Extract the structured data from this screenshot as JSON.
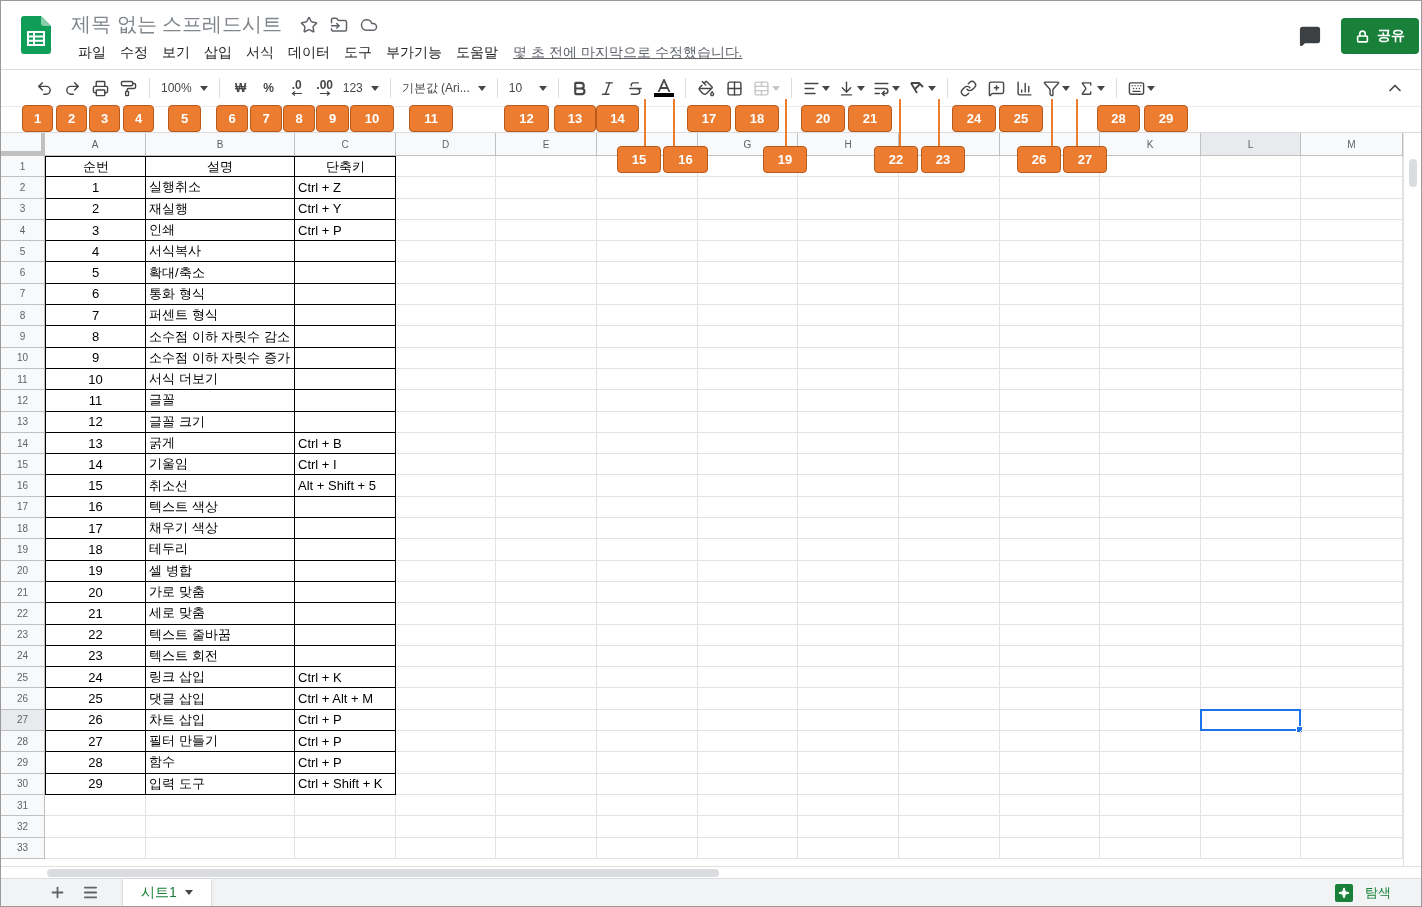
{
  "document": {
    "title": "제목 없는 스프레드시트",
    "last_edit": "몇 초 전에 마지막으로 수정했습니다."
  },
  "menu": [
    "파일",
    "수정",
    "보기",
    "삽입",
    "서식",
    "데이터",
    "도구",
    "부가기능",
    "도움말"
  ],
  "share_button": {
    "label": "공유"
  },
  "toolbar": {
    "groups": [
      [
        {
          "kind": "icon",
          "disabled": false
        },
        {
          "kind": "icon",
          "disabled": false
        },
        {
          "kind": "icon",
          "disabled": false
        },
        {
          "kind": "icon",
          "disabled": false
        }
      ],
      [
        {
          "kind": "dropdown",
          "label": "100%",
          "disabled": false
        }
      ],
      [
        {
          "kind": "text",
          "label": "₩",
          "disabled": false
        },
        {
          "kind": "text",
          "label": "%",
          "disabled": false
        },
        {
          "kind": "decimal",
          "label": ".0",
          "disabled": false
        },
        {
          "kind": "decimal",
          "label": ".00",
          "disabled": false
        },
        {
          "kind": "dropdown",
          "label": "123",
          "disabled": false
        }
      ],
      [
        {
          "kind": "dropdown",
          "label": "기본값 (Ari...",
          "disabled": false
        }
      ],
      [
        {
          "kind": "dropdown",
          "label": "10",
          "disabled": false
        }
      ],
      [
        {
          "kind": "icon",
          "disabled": false
        },
        {
          "kind": "icon",
          "disabled": false
        },
        {
          "kind": "icon",
          "disabled": false
        },
        {
          "kind": "icon",
          "disabled": false
        }
      ],
      [
        {
          "kind": "icon",
          "disabled": false
        },
        {
          "kind": "icon",
          "disabled": false
        },
        {
          "kind": "icon",
          "disabled": true
        }
      ],
      [
        {
          "kind": "icon",
          "disabled": false
        },
        {
          "kind": "icon",
          "disabled": false
        },
        {
          "kind": "icon",
          "disabled": false
        },
        {
          "kind": "icon",
          "disabled": false
        }
      ],
      [
        {
          "kind": "icon",
          "disabled": false
        },
        {
          "kind": "icon",
          "disabled": false
        },
        {
          "kind": "icon",
          "disabled": false
        },
        {
          "kind": "icon",
          "disabled": false
        },
        {
          "kind": "icon",
          "disabled": false
        }
      ],
      [
        {
          "kind": "icon",
          "disabled": false
        }
      ]
    ]
  },
  "callouts": [
    {
      "label": "1"
    },
    {
      "label": "2"
    },
    {
      "label": "3"
    },
    {
      "label": "4"
    },
    {
      "label": "5"
    },
    {
      "label": "6"
    },
    {
      "label": "7"
    },
    {
      "label": "8"
    },
    {
      "label": "9"
    },
    {
      "label": "10"
    },
    {
      "label": "11"
    },
    {
      "label": "12"
    },
    {
      "label": "13"
    },
    {
      "label": "14"
    },
    {
      "label": "15"
    },
    {
      "label": "16"
    },
    {
      "label": "17"
    },
    {
      "label": "18"
    },
    {
      "label": "19"
    },
    {
      "label": "20"
    },
    {
      "label": "21"
    },
    {
      "label": "22"
    },
    {
      "label": "23"
    },
    {
      "label": "24"
    },
    {
      "label": "25"
    },
    {
      "label": "26"
    },
    {
      "label": "27"
    },
    {
      "label": "28"
    },
    {
      "label": "29"
    }
  ],
  "grid": {
    "columns": [
      {
        "label": "A",
        "selected": false
      },
      {
        "label": "B",
        "selected": false
      },
      {
        "label": "C",
        "selected": false
      },
      {
        "label": "D",
        "selected": false
      },
      {
        "label": "E",
        "selected": false
      },
      {
        "selected": false
      },
      {
        "label": "G",
        "selected": false
      },
      {
        "label": "H",
        "selected": false
      },
      {
        "selected": false
      },
      {
        "selected": false
      },
      {
        "label": "K",
        "selected": false
      },
      {
        "label": "L",
        "selected": true
      },
      {
        "label": "M",
        "selected": false
      }
    ],
    "rows": [
      {
        "number": "1",
        "selected": false,
        "cells": [
          "순번",
          "설명",
          "단축키"
        ]
      },
      {
        "number": "2",
        "selected": false,
        "cells": [
          "1",
          "실행취소",
          "Ctrl + Z"
        ]
      },
      {
        "number": "3",
        "selected": false,
        "cells": [
          "2",
          "재실행",
          "Ctrl + Y"
        ]
      },
      {
        "number": "4",
        "selected": false,
        "cells": [
          "3",
          "인쇄",
          "Ctrl + P"
        ]
      },
      {
        "number": "5",
        "selected": false,
        "cells": [
          "4",
          "서식복사"
        ]
      },
      {
        "number": "6",
        "selected": false,
        "cells": [
          "5",
          "확대/축소"
        ]
      },
      {
        "number": "7",
        "selected": false,
        "cells": [
          "6",
          "통화 형식"
        ]
      },
      {
        "number": "8",
        "selected": false,
        "cells": [
          "7",
          "퍼센트 형식"
        ]
      },
      {
        "number": "9",
        "selected": false,
        "cells": [
          "8",
          "소수점 이하 자릿수 감소"
        ]
      },
      {
        "number": "10",
        "selected": false,
        "cells": [
          "9",
          "소수점 이하 자릿수 증가"
        ]
      },
      {
        "number": "11",
        "selected": false,
        "cells": [
          "10",
          "서식 더보기"
        ]
      },
      {
        "number": "12",
        "selected": false,
        "cells": [
          "11",
          "글꼴"
        ]
      },
      {
        "number": "13",
        "selected": false,
        "cells": [
          "12",
          "글꼴 크기"
        ]
      },
      {
        "number": "14",
        "selected": false,
        "cells": [
          "13",
          "굵게",
          "Ctrl + B"
        ]
      },
      {
        "number": "15",
        "selected": false,
        "cells": [
          "14",
          "기울임",
          "Ctrl + I"
        ]
      },
      {
        "number": "16",
        "selected": false,
        "cells": [
          "15",
          "취소선",
          "Alt + Shift + 5"
        ]
      },
      {
        "number": "17",
        "selected": false,
        "cells": [
          "16",
          "텍스트 색상"
        ]
      },
      {
        "number": "18",
        "selected": false,
        "cells": [
          "17",
          "채우기 색상"
        ]
      },
      {
        "number": "19",
        "selected": false,
        "cells": [
          "18",
          "테두리"
        ]
      },
      {
        "number": "20",
        "selected": false,
        "cells": [
          "19",
          "셀 병합"
        ]
      },
      {
        "number": "21",
        "selected": false,
        "cells": [
          "20",
          "가로 맞춤"
        ]
      },
      {
        "number": "22",
        "selected": false,
        "cells": [
          "21",
          "세로 맞춤"
        ]
      },
      {
        "number": "23",
        "selected": false,
        "cells": [
          "22",
          "텍스트 줄바꿈"
        ]
      },
      {
        "number": "24",
        "selected": false,
        "cells": [
          "23",
          "텍스트 회전"
        ]
      },
      {
        "number": "25",
        "selected": false,
        "cells": [
          "24",
          "링크 삽입",
          "Ctrl + K"
        ]
      },
      {
        "number": "26",
        "selected": false,
        "cells": [
          "25",
          "댓글 삽입",
          "Ctrl + Alt + M"
        ]
      },
      {
        "number": "27",
        "selected": true,
        "cells": [
          "26",
          "차트 삽입",
          "Ctrl + P"
        ]
      },
      {
        "number": "28",
        "selected": false,
        "cells": [
          "27",
          "필터 만들기",
          "Ctrl + P"
        ]
      },
      {
        "number": "29",
        "selected": false,
        "cells": [
          "28",
          "함수",
          "Ctrl + P"
        ]
      },
      {
        "number": "30",
        "selected": false,
        "cells": [
          "29",
          "입력 도구",
          "Ctrl + Shift + K"
        ]
      },
      {
        "number": "31",
        "selected": false
      },
      {
        "number": "32",
        "selected": false
      },
      {
        "number": "33",
        "selected": false
      }
    ]
  },
  "sheet_tabs": [
    {
      "label": "시트1",
      "selected": true
    }
  ],
  "explore_button": {
    "label": "탐색"
  }
}
